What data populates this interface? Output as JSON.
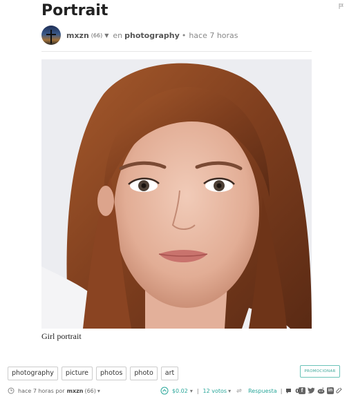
{
  "post": {
    "title": "Portrait",
    "author": "mxzn",
    "reputation": "(66)",
    "in_label": "en",
    "category": "photography",
    "time": "hace 7 horas",
    "caption": "Girl portrait"
  },
  "tags": [
    "photography",
    "picture",
    "photos",
    "photo",
    "art"
  ],
  "promote_label": "PROMOCIONAR",
  "footer": {
    "time": "hace 7 horas por",
    "author": "mxzn",
    "reputation": "(66)",
    "payout": "$0.02",
    "votes": "12 votos",
    "reply": "Respuesta",
    "comments": "0"
  },
  "colors": {
    "accent": "#2aa79a",
    "text": "#333333"
  },
  "icons": [
    "flag-icon",
    "clock-icon",
    "upvote-icon",
    "reblog-icon",
    "comment-icon",
    "facebook-icon",
    "twitter-icon",
    "reddit-icon",
    "linkedin-icon",
    "link-icon"
  ]
}
